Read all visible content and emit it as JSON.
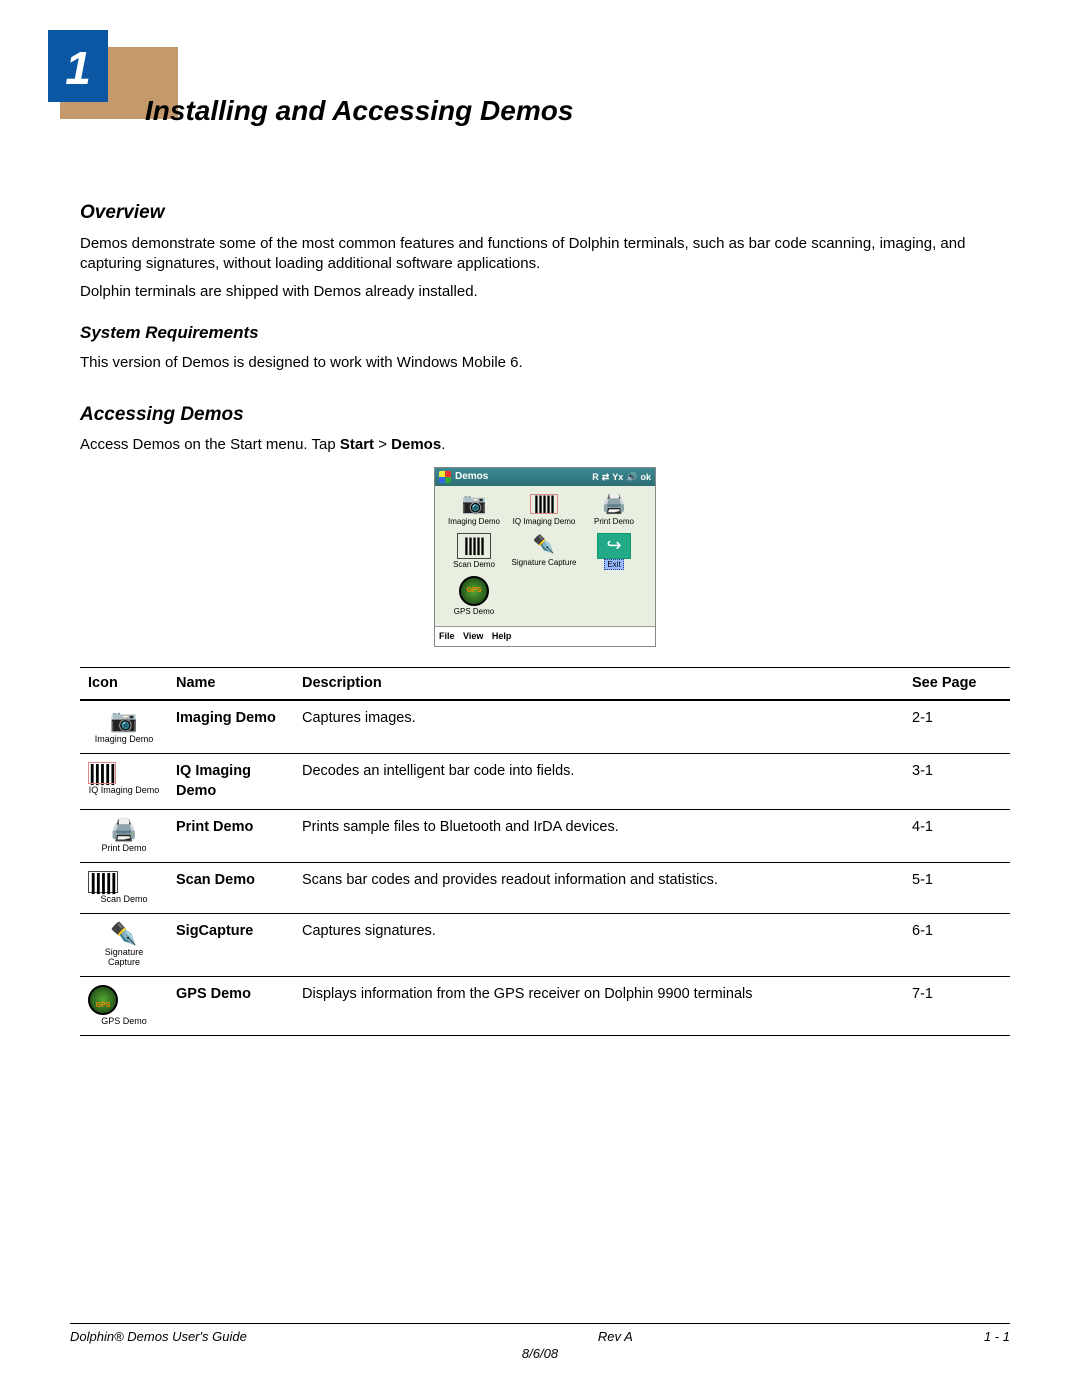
{
  "chapter": {
    "number": "1",
    "title": "Installing and Accessing Demos"
  },
  "sections": {
    "overview": {
      "heading": "Overview",
      "p1": "Demos demonstrate some of the most common features and functions of Dolphin terminals, such as bar code scanning, imaging, and capturing signatures, without loading additional software applications.",
      "p2": "Dolphin terminals are shipped with Demos already installed."
    },
    "sysreq": {
      "heading": "System Requirements",
      "p1": "This version of Demos is designed to work with Windows Mobile 6."
    },
    "accessing": {
      "heading": "Accessing Demos",
      "intro_a": "Access Demos on the Start menu. Tap ",
      "intro_b": "Start",
      "intro_c": " > ",
      "intro_d": "Demos",
      "intro_e": "."
    }
  },
  "device": {
    "title": "Demos",
    "status_icons": [
      "R",
      "⇄",
      "Yx",
      "🔊",
      "ok"
    ],
    "icons": [
      {
        "label": "Imaging Demo"
      },
      {
        "label": "IQ Imaging Demo"
      },
      {
        "label": "Print Demo"
      },
      {
        "label": "Scan Demo"
      },
      {
        "label": "Signature Capture"
      },
      {
        "label": "Exit",
        "selected": true
      },
      {
        "label": "GPS Demo"
      }
    ],
    "menu": [
      "File",
      "View",
      "Help"
    ]
  },
  "table": {
    "headers": {
      "icon": "Icon",
      "name": "Name",
      "desc": "Description",
      "page": "See Page"
    },
    "rows": [
      {
        "iconLabel": "Imaging Demo",
        "glyphClass": "cg-camera",
        "name": "Imaging Demo",
        "desc": "Captures images.",
        "page": "2-1"
      },
      {
        "iconLabel": "IQ Imaging Demo",
        "glyphClass": "cg-barcodec",
        "name": "IQ Imaging Demo",
        "desc": "Decodes an intelligent bar code into fields.",
        "page": "3-1"
      },
      {
        "iconLabel": "Print Demo",
        "glyphClass": "cg-printer",
        "name": "Print Demo",
        "desc": "Prints sample files to Bluetooth and IrDA devices.",
        "page": "4-1"
      },
      {
        "iconLabel": "Scan Demo",
        "glyphClass": "cg-barcode",
        "name": "Scan Demo",
        "desc": "Scans bar codes and provides readout information and statistics.",
        "page": "5-1"
      },
      {
        "iconLabel": "Signature Capture",
        "glyphClass": "cg-pen",
        "name": "SigCapture",
        "desc": "Captures signatures.",
        "page": "6-1"
      },
      {
        "iconLabel": "GPS Demo",
        "glyphClass": "cg-gps",
        "name": "GPS Demo",
        "desc": "Displays information from the GPS receiver on Dolphin 9900 terminals",
        "page": "7-1"
      }
    ]
  },
  "footer": {
    "left": "Dolphin® Demos User's Guide",
    "center1": "Rev A",
    "center2": "8/6/08",
    "right": "1 - 1"
  }
}
